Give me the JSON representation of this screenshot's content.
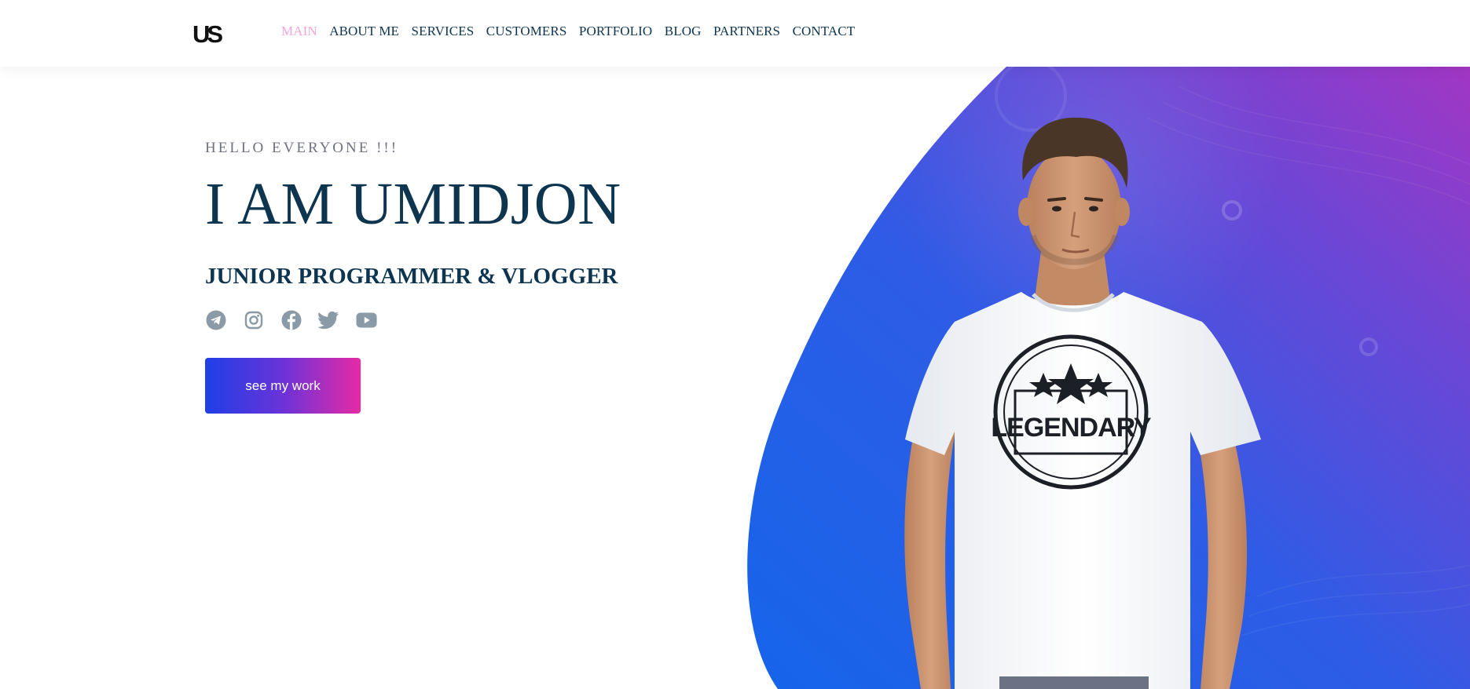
{
  "header": {
    "logo_text": "US",
    "nav": [
      {
        "label": "MAIN",
        "active": true
      },
      {
        "label": "ABOUT ME",
        "active": false
      },
      {
        "label": "SERVICES",
        "active": false
      },
      {
        "label": "CUSTOMERS",
        "active": false
      },
      {
        "label": "PORTFOLIO",
        "active": false
      },
      {
        "label": "BLOG",
        "active": false
      },
      {
        "label": "PARTNERS",
        "active": false
      },
      {
        "label": "CONTACT",
        "active": false
      }
    ]
  },
  "hero": {
    "greeting": "HELLO EVERYONE !!!",
    "headline": "I AM UMIDJON",
    "subtitle": "JUNIOR PROGRAMMER & VLOGGER",
    "cta_label": "see my work",
    "socials": [
      "telegram-icon",
      "instagram-icon",
      "facebook-icon",
      "twitter-icon",
      "youtube-icon"
    ],
    "shirt_text": "LEGENDARY"
  },
  "colors": {
    "nav_text": "#0d3550",
    "nav_active": "#f3a6d9",
    "headline": "#0d3550",
    "greeting": "#6f7280",
    "social_icon": "#8a9aa6",
    "blob_start": "#1e5ae8",
    "blob_end": "#9a36c9",
    "cta_start": "#1f3fe6",
    "cta_end": "#e62aa6"
  }
}
